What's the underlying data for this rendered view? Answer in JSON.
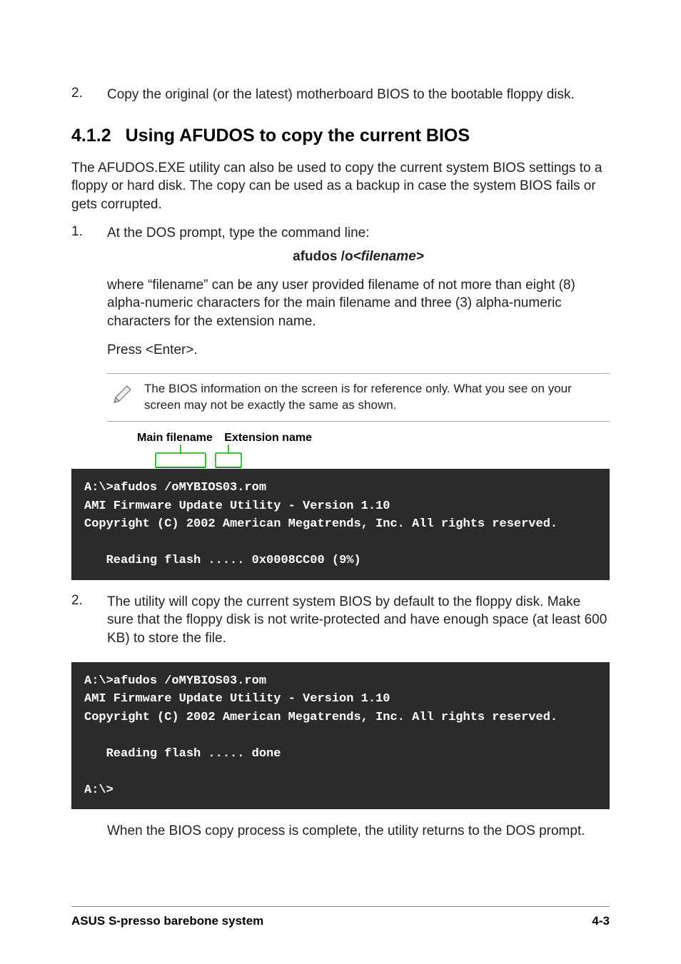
{
  "step2_top": {
    "num": "2.",
    "text": "Copy the original (or the latest) motherboard BIOS to the bootable floppy disk."
  },
  "section": {
    "num": "4.1.2",
    "title": "Using AFUDOS to copy the current BIOS"
  },
  "intro": "The AFUDOS.EXE utility can also be used to copy the current system BIOS settings to a floppy or hard disk. The copy can be used as a backup in case the system BIOS fails or gets corrupted.",
  "step1": {
    "num": "1.",
    "text": "At the DOS prompt, type the command line:",
    "command_prefix": "afudos /o",
    "command_suffix": "<filename>",
    "where": "where “filename” can be any user provided filename of not more than eight (8) alpha-numeric characters for the main filename and three (3) alpha-numeric characters for the extension name.",
    "press": "Press <Enter>."
  },
  "note": "The BIOS information on the screen is for reference only. What you see on your screen may not be exactly the same as shown.",
  "labels": {
    "main": "Main filename",
    "ext": "Extension name"
  },
  "terminal1": "A:\\>afudos /oMYBIOS03.rom\nAMI Firmware Update Utility - Version 1.10\nCopyright (C) 2002 American Megatrends, Inc. All rights reserved.\n\n   Reading flash ..... 0x0008CC00 (9%)",
  "step2_bottom": {
    "num": "2.",
    "text": "The utility will copy the current system BIOS by default to the floppy disk. Make sure that the floppy disk is not write-protected and have enough space (at least 600 KB) to store the file."
  },
  "terminal2": "A:\\>afudos /oMYBIOS03.rom\nAMI Firmware Update Utility - Version 1.10\nCopyright (C) 2002 American Megatrends, Inc. All rights reserved.\n\n   Reading flash ..... done\n\nA:\\>",
  "closing": "When the BIOS copy process is complete, the utility returns to the DOS prompt.",
  "footer": {
    "left": "ASUS S-presso barebone system",
    "right": "4-3"
  }
}
